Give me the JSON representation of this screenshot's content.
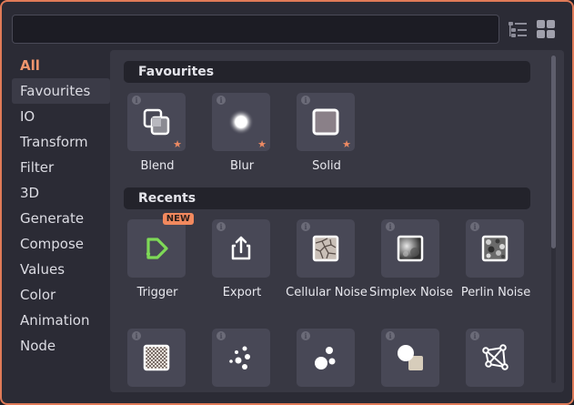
{
  "search": {
    "value": "",
    "placeholder": ""
  },
  "sidebar": {
    "items": [
      {
        "label": "All"
      },
      {
        "label": "Favourites"
      },
      {
        "label": "IO"
      },
      {
        "label": "Transform"
      },
      {
        "label": "Filter"
      },
      {
        "label": "3D"
      },
      {
        "label": "Generate"
      },
      {
        "label": "Compose"
      },
      {
        "label": "Values"
      },
      {
        "label": "Color"
      },
      {
        "label": "Animation"
      },
      {
        "label": "Node"
      }
    ]
  },
  "sections": {
    "favourites": {
      "title": "Favourites",
      "items": [
        {
          "label": "Blend",
          "icon": "blend-icon",
          "favourite": true
        },
        {
          "label": "Blur",
          "icon": "blur-icon",
          "favourite": true
        },
        {
          "label": "Solid",
          "icon": "solid-icon",
          "favourite": true
        }
      ]
    },
    "recents": {
      "title": "Recents",
      "items": [
        {
          "label": "Trigger",
          "icon": "trigger-icon",
          "badge": "NEW"
        },
        {
          "label": "Export",
          "icon": "export-icon"
        },
        {
          "label": "Cellular Noise",
          "icon": "cellular-noise-icon"
        },
        {
          "label": "Simplex Noise",
          "icon": "simplex-noise-icon"
        },
        {
          "label": "Perlin Noise",
          "icon": "perlin-noise-icon"
        },
        {
          "label": "",
          "icon": "pattern-icon"
        },
        {
          "label": "",
          "icon": "dots-icon"
        },
        {
          "label": "",
          "icon": "circles-icon"
        },
        {
          "label": "",
          "icon": "shapes-icon"
        },
        {
          "label": "",
          "icon": "mesh-icon"
        }
      ]
    }
  },
  "colors": {
    "accent": "#e07a57",
    "badge": "#f2895e",
    "trigger_green": "#7ed957"
  }
}
